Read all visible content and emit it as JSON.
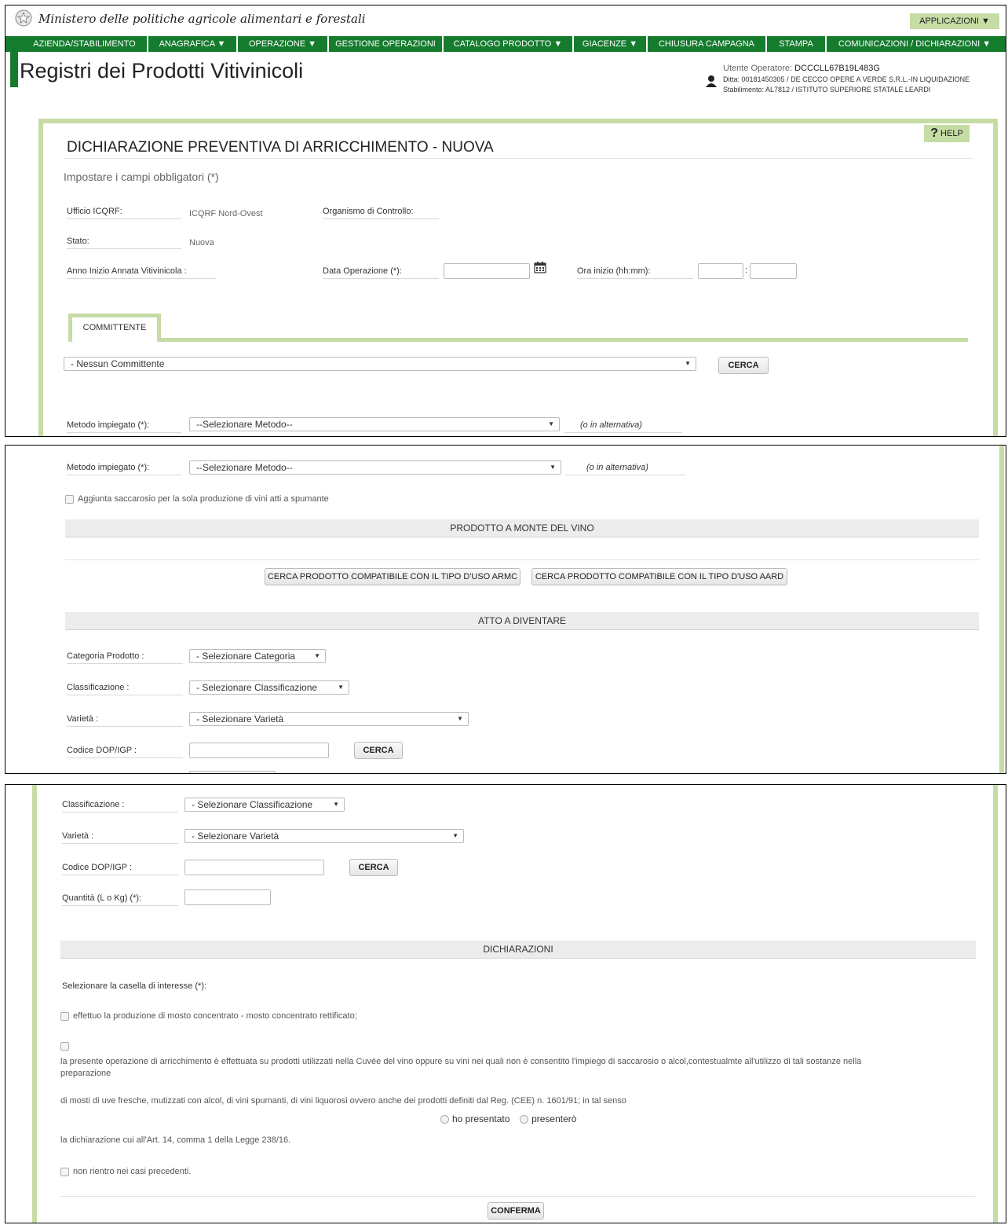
{
  "header": {
    "ministry": "Ministero delle politiche agricole alimentari e forestali",
    "applications": "APPLICAZIONI ▼",
    "title": "Registri dei Prodotti Vitivinicoli",
    "user_label": "Utente Operatore:",
    "user_value": "DCCCLL67B19L483G",
    "ditta": "Ditta: 00181450305 / DE CECCO OPERE A VERDE S.R.L.-IN LIQUIDAZIONE",
    "stabilimento": "Stabilimento: AL7812 / ISTITUTO SUPERIORE STATALE LEARDI"
  },
  "nav": [
    "AZIENDA/STABILIMENTO",
    "ANAGRAFICA ▼",
    "OPERAZIONE ▼",
    "GESTIONE OPERAZIONI",
    "CATALOGO PRODOTTO ▼",
    "GIACENZE ▼",
    "CHIUSURA CAMPAGNA",
    "STAMPA",
    "COMUNICAZIONI / DICHIARAZIONI ▼"
  ],
  "help": "HELP",
  "form": {
    "title": "DICHIARAZIONE PREVENTIVA DI ARRICCHIMENTO - NUOVA",
    "subtitle": "Impostare i campi obbligatori (*)",
    "ufficio_label": "Ufficio ICQRF:",
    "ufficio_value": "ICQRF Nord-Ovest",
    "organismo_label": "Organismo di Controllo:",
    "stato_label": "Stato:",
    "stato_value": "Nuova",
    "anno_label": "Anno Inizio Annata Vitivinicola :",
    "data_label": "Data Operazione (*):",
    "ora_label": "Ora inizio (hh:mm):",
    "ora_sep": ":",
    "tab_committente": "COMMITTENTE",
    "committente_select": "- Nessun Committente",
    "cerca": "CERCA",
    "metodo_label": "Metodo impiegato (*):",
    "metodo_select": "--Selezionare Metodo--",
    "alternativa": "(o in alternativa)",
    "saccarosio": "Aggiunta saccarosio per la sola produzione di vini atti a spumante",
    "section_prodotto": "PRODOTTO A MONTE DEL VINO",
    "cerca_armc": "CERCA PRODOTTO COMPATIBILE CON IL TIPO D'USO ARMC",
    "cerca_aard": "CERCA PRODOTTO COMPATIBILE CON IL TIPO D'USO AARD",
    "section_atto": "ATTO A DIVENTARE",
    "categoria_label": "Categoria Prodotto :",
    "categoria_select": "- Selezionare Categoria",
    "classificazione_label": "Classificazione :",
    "classificazione_select": "- Selezionare Classificazione",
    "varieta_label": "Varietà :",
    "varieta_select": "- Selezionare Varietà",
    "codice_label": "Codice DOP/IGP :",
    "quantita_label": "Quantità (L o Kg)  (*):",
    "section_dichiarazioni": "DICHIARAZIONI",
    "selezionare_casella": "Selezionare la casella di interesse (*):",
    "dich_1": "effettuo la produzione di mosto concentrato - mosto concentrato rettificato;",
    "dich_2_line1": "la presente operazione di arricchimento è effettuata su prodotti utilizzati nella Cuvée del vino oppure su vini nei quali non è consentito l'impiego di saccarosio o alcol,contestualmte all'utilizzo di tali sostanze nella",
    "dich_2_line2": "preparazione",
    "dich_2_line3": "di mosti di uve fresche, mutizzati con alcol, di vini spumanti, di vini liquorosi ovvero anche dei prodotti definiti dal Reg. (CEE) n. 1601/91; in tal senso",
    "ho_presentato": "ho presentato",
    "presentero": "presenterò",
    "dich_2_line4": "la dichiarazione cui all'Art. 14, comma 1 della Legge 238/16.",
    "dich_3": "non rientro nei casi precedenti.",
    "conferma": "CONFERMA"
  },
  "colors": {
    "nav_green": "#157c2e",
    "frame_green": "#c6dca5",
    "section_gray": "#ececec"
  }
}
